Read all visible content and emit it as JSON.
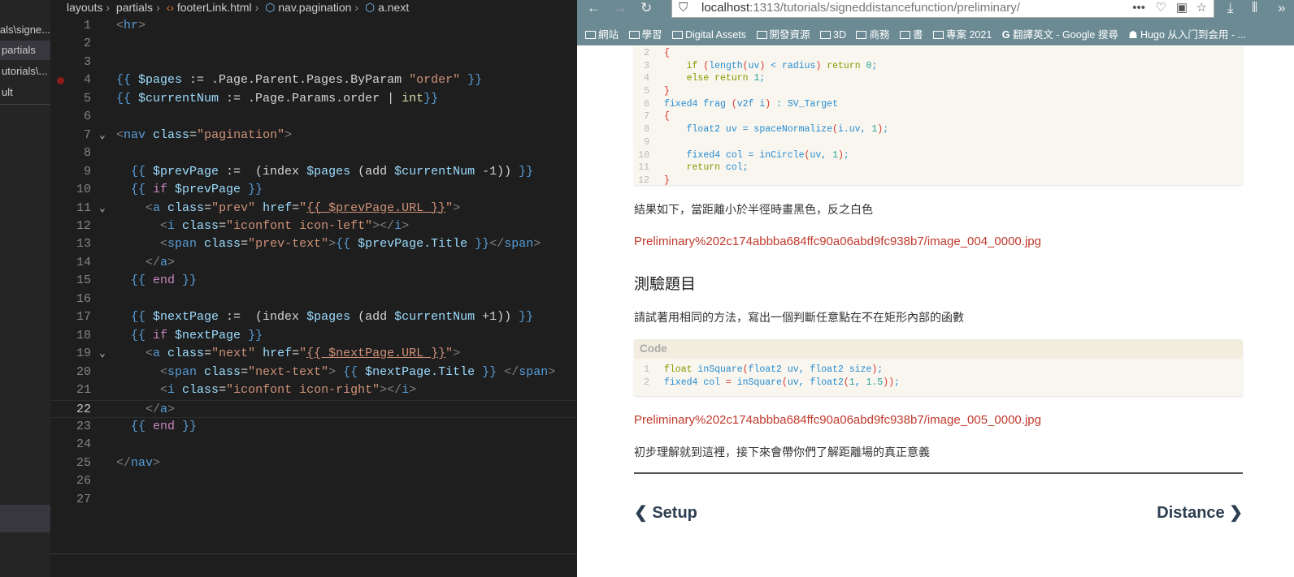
{
  "editor": {
    "breadcrumb": [
      "layouts",
      "partials",
      "footerLink.html",
      "nav.pagination",
      "a.next"
    ],
    "sidebar": [
      "als\\signe...",
      "partials",
      "utorials\\...",
      "ult"
    ],
    "current_line": 22,
    "breakpoint_line": 4,
    "lines": [
      [
        [
          "b",
          "<"
        ],
        [
          "t",
          "hr"
        ],
        [
          "b",
          ">"
        ]
      ],
      [],
      [],
      [
        [
          "k",
          "{{ "
        ],
        [
          "v",
          "$pages"
        ],
        [
          "p",
          " := .Page.Parent.Pages.ByParam "
        ],
        [
          "s",
          "\"order\""
        ],
        [
          "k",
          " }}"
        ]
      ],
      [
        [
          "k",
          "{{ "
        ],
        [
          "v",
          "$currentNum"
        ],
        [
          "p",
          " := .Page.Params.order | "
        ],
        [
          "f",
          "int"
        ],
        [
          "k",
          "}}"
        ]
      ],
      [],
      [
        [
          "b",
          "<"
        ],
        [
          "t",
          "nav"
        ],
        [
          "a",
          " class"
        ],
        [
          "p",
          "="
        ],
        [
          "s",
          "\"pagination\""
        ],
        [
          "b",
          ">"
        ]
      ],
      [],
      [
        [
          "p",
          "  "
        ],
        [
          "k",
          "{{ "
        ],
        [
          "v",
          "$prevPage"
        ],
        [
          "p",
          " :=  (index "
        ],
        [
          "v",
          "$pages"
        ],
        [
          "p",
          " (add "
        ],
        [
          "v",
          "$currentNum"
        ],
        [
          "p",
          " -1)) "
        ],
        [
          "k",
          "}}"
        ]
      ],
      [
        [
          "p",
          "  "
        ],
        [
          "k",
          "{{ "
        ],
        [
          "kw",
          "if"
        ],
        [
          "v",
          " $prevPage"
        ],
        [
          "k",
          " }}"
        ]
      ],
      [
        [
          "p",
          "    "
        ],
        [
          "b",
          "<"
        ],
        [
          "t",
          "a"
        ],
        [
          "a",
          " class"
        ],
        [
          "p",
          "="
        ],
        [
          "s",
          "\"prev\""
        ],
        [
          "a",
          " href"
        ],
        [
          "p",
          "="
        ],
        [
          "s",
          "\""
        ],
        [
          "su",
          "{{ $prevPage.URL }}"
        ],
        [
          "s",
          "\""
        ],
        [
          "b",
          ">"
        ]
      ],
      [
        [
          "p",
          "      "
        ],
        [
          "b",
          "<"
        ],
        [
          "t",
          "i"
        ],
        [
          "a",
          " class"
        ],
        [
          "p",
          "="
        ],
        [
          "s",
          "\"iconfont icon-left\""
        ],
        [
          "b",
          "></"
        ],
        [
          "t",
          "i"
        ],
        [
          "b",
          ">"
        ]
      ],
      [
        [
          "p",
          "      "
        ],
        [
          "b",
          "<"
        ],
        [
          "t",
          "span"
        ],
        [
          "a",
          " class"
        ],
        [
          "p",
          "="
        ],
        [
          "s",
          "\"prev-text\""
        ],
        [
          "b",
          ">"
        ],
        [
          "k",
          "{{ "
        ],
        [
          "v",
          "$prevPage.Title"
        ],
        [
          "k",
          " }}"
        ],
        [
          "b",
          "</"
        ],
        [
          "t",
          "span"
        ],
        [
          "b",
          ">"
        ]
      ],
      [
        [
          "p",
          "    "
        ],
        [
          "b",
          "</"
        ],
        [
          "t",
          "a"
        ],
        [
          "b",
          ">"
        ]
      ],
      [
        [
          "p",
          "  "
        ],
        [
          "k",
          "{{ "
        ],
        [
          "kw",
          "end"
        ],
        [
          "k",
          " }}"
        ]
      ],
      [],
      [
        [
          "p",
          "  "
        ],
        [
          "k",
          "{{ "
        ],
        [
          "v",
          "$nextPage"
        ],
        [
          "p",
          " :=  (index "
        ],
        [
          "v",
          "$pages"
        ],
        [
          "p",
          " (add "
        ],
        [
          "v",
          "$currentNum"
        ],
        [
          "p",
          " +1)) "
        ],
        [
          "k",
          "}}"
        ]
      ],
      [
        [
          "p",
          "  "
        ],
        [
          "k",
          "{{ "
        ],
        [
          "kw",
          "if"
        ],
        [
          "v",
          " $nextPage"
        ],
        [
          "k",
          " }}"
        ]
      ],
      [
        [
          "p",
          "    "
        ],
        [
          "b",
          "<"
        ],
        [
          "t",
          "a"
        ],
        [
          "a",
          " class"
        ],
        [
          "p",
          "="
        ],
        [
          "s",
          "\"next\""
        ],
        [
          "a",
          " href"
        ],
        [
          "p",
          "="
        ],
        [
          "s",
          "\""
        ],
        [
          "su",
          "{{ $nextPage.URL }}"
        ],
        [
          "s",
          "\""
        ],
        [
          "b",
          ">"
        ]
      ],
      [
        [
          "p",
          "      "
        ],
        [
          "b",
          "<"
        ],
        [
          "t",
          "span"
        ],
        [
          "a",
          " class"
        ],
        [
          "p",
          "="
        ],
        [
          "s",
          "\"next-text\""
        ],
        [
          "b",
          "> "
        ],
        [
          "k",
          "{{ "
        ],
        [
          "v",
          "$nextPage.Title"
        ],
        [
          "k",
          " }}"
        ],
        [
          "b",
          " </"
        ],
        [
          "t",
          "span"
        ],
        [
          "b",
          ">"
        ]
      ],
      [
        [
          "p",
          "      "
        ],
        [
          "b",
          "<"
        ],
        [
          "t",
          "i"
        ],
        [
          "a",
          " class"
        ],
        [
          "p",
          "="
        ],
        [
          "s",
          "\"iconfont icon-right\""
        ],
        [
          "b",
          "></"
        ],
        [
          "t",
          "i"
        ],
        [
          "b",
          ">"
        ]
      ],
      [
        [
          "p",
          "    "
        ],
        [
          "b",
          "</"
        ],
        [
          "t",
          "a"
        ],
        [
          "b",
          ">"
        ]
      ],
      [
        [
          "p",
          "  "
        ],
        [
          "k",
          "{{ "
        ],
        [
          "kw",
          "end"
        ],
        [
          "k",
          " }}"
        ]
      ],
      [],
      [
        [
          "b",
          "</"
        ],
        [
          "t",
          "nav"
        ],
        [
          "b",
          ">"
        ]
      ],
      [],
      []
    ],
    "fold_lines": [
      7,
      11,
      19
    ]
  },
  "browser": {
    "url_host": "localhost",
    "url_rest": ":1313/tutorials/signeddistancefunction/preliminary/",
    "bookmarks": [
      "網站",
      "學習",
      "Digital Assets",
      "開發資源",
      "3D",
      "商務",
      "書",
      "專案 2021",
      "翻譯英文 - Google 搜尋",
      "Hugo 从入门到会用 - ..."
    ],
    "code1": [
      {
        "n": "2",
        "tokens": [
          [
            "cr",
            "{"
          ]
        ]
      },
      {
        "n": "3",
        "tokens": [
          [
            "cpl",
            "    "
          ],
          [
            "ck",
            "if "
          ],
          [
            "cr",
            "("
          ],
          [
            "cp",
            "length"
          ],
          [
            "cr",
            "("
          ],
          [
            "cp",
            "uv"
          ],
          [
            "cr",
            ")"
          ],
          [
            "cp",
            " < radius"
          ],
          [
            "cr",
            ")"
          ],
          [
            "ck",
            " return "
          ],
          [
            "cn",
            "0"
          ],
          [
            "cp",
            ";"
          ]
        ]
      },
      {
        "n": "4",
        "tokens": [
          [
            "cpl",
            "    "
          ],
          [
            "ck",
            "else return "
          ],
          [
            "cn",
            "1"
          ],
          [
            "cp",
            ";"
          ]
        ]
      },
      {
        "n": "5",
        "tokens": [
          [
            "cr",
            "}"
          ]
        ]
      },
      {
        "n": "6",
        "tokens": [
          [
            "cp",
            "fixed4 frag "
          ],
          [
            "cr",
            "("
          ],
          [
            "cp",
            "v2f i"
          ],
          [
            "cr",
            ")"
          ],
          [
            "cp",
            " : SV_Target"
          ]
        ]
      },
      {
        "n": "7",
        "tokens": [
          [
            "cr",
            "{"
          ]
        ]
      },
      {
        "n": "8",
        "tokens": [
          [
            "cpl",
            "    "
          ],
          [
            "cp",
            "float2 uv = spaceNormalize"
          ],
          [
            "cr",
            "("
          ],
          [
            "cp",
            "i.uv, "
          ],
          [
            "cn",
            "1"
          ],
          [
            "cr",
            ")"
          ],
          [
            "cp",
            ";"
          ]
        ]
      },
      {
        "n": "9",
        "tokens": []
      },
      {
        "n": "10",
        "tokens": [
          [
            "cpl",
            "    "
          ],
          [
            "cp",
            "fixed4 col = inCircle"
          ],
          [
            "cr",
            "("
          ],
          [
            "cp",
            "uv, "
          ],
          [
            "cn",
            "1"
          ],
          [
            "cr",
            ")"
          ],
          [
            "cp",
            ";"
          ]
        ]
      },
      {
        "n": "11",
        "tokens": [
          [
            "cpl",
            "    "
          ],
          [
            "ck",
            "return "
          ],
          [
            "cp",
            "col;"
          ]
        ]
      },
      {
        "n": "12",
        "tokens": [
          [
            "cr",
            "}"
          ]
        ]
      }
    ],
    "para1": "結果如下，當距離小於半徑時畫黑色，反之白色",
    "image1": "Preliminary%202c174abbba684ffc90a06abd9fc938b7/image_004_0000.jpg",
    "heading": "測驗題目",
    "para2": "請試著用相同的方法，寫出一個判斷任意點在不在矩形內部的函數",
    "code2_label": "Code",
    "code2": [
      {
        "n": "1",
        "tokens": [
          [
            "ck",
            "float "
          ],
          [
            "cp",
            "inSquare"
          ],
          [
            "cr",
            "("
          ],
          [
            "cp",
            "float2 uv, float2 size"
          ],
          [
            "cr",
            ")"
          ],
          [
            "cp",
            ";"
          ]
        ]
      },
      {
        "n": "2",
        "tokens": [
          [
            "cp",
            "fixed4 col "
          ],
          [
            "cr",
            "="
          ],
          [
            "cp",
            " inSquare"
          ],
          [
            "cr",
            "("
          ],
          [
            "cp",
            "uv, float2"
          ],
          [
            "cr",
            "("
          ],
          [
            "cn",
            "1"
          ],
          [
            "cp",
            ", "
          ],
          [
            "cn",
            "1.5"
          ],
          [
            "cr",
            "))"
          ],
          [
            "cp",
            ";"
          ]
        ]
      }
    ],
    "image2": "Preliminary%202c174abbba684ffc90a06abd9fc938b7/image_005_0000.jpg",
    "para3": "初步理解就到這裡，接下來會帶你們了解距離場的真正意義",
    "prev_label": "Setup",
    "next_label": "Distance"
  }
}
